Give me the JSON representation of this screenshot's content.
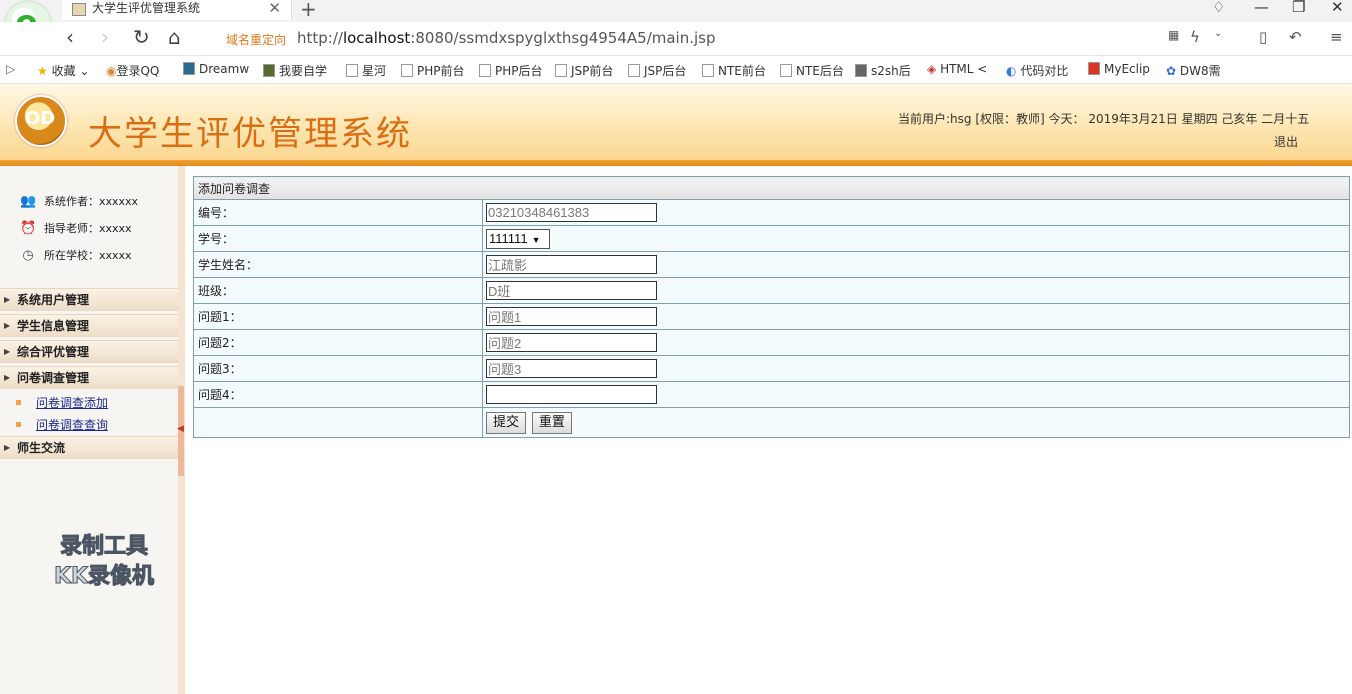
{
  "browser": {
    "tab_title": "大学生评优管理系统",
    "redirect_label": "域名重定向",
    "url_prefix": "http://",
    "url_host": "localhost",
    "url_rest": ":8080/ssmdxspyglxthsg4954A5/main.jsp",
    "bookmarks": [
      "收藏",
      "登录QQ",
      "Dreamw",
      "我要自学",
      "星河",
      "PHP前台",
      "PHP后台",
      "JSP前台",
      "JSP后台",
      "NTE前台",
      "NTE后台",
      "s2sh后",
      "HTML <",
      "代码对比",
      "MyEclip",
      "DW8需"
    ]
  },
  "header": {
    "title": "大学生评优管理系统",
    "user_info": "当前用户:hsg [权限：教师] 今天： 2019年3月21日 星期四 己亥年 二月十五",
    "logout": "退出"
  },
  "sidebar": {
    "info": [
      {
        "label": "系统作者：xxxxxx",
        "icon": "users-icon"
      },
      {
        "label": "指导老师：xxxxx",
        "icon": "alarm-icon"
      },
      {
        "label": "所在学校：xxxxx",
        "icon": "clock-icon"
      }
    ],
    "menus": [
      "系统用户管理",
      "学生信息管理",
      "综合评优管理",
      "问卷调查管理",
      "师生交流"
    ],
    "sub_items": [
      "问卷调查添加",
      "问卷调查查询"
    ],
    "watermark": [
      "录制工具",
      "KK录像机"
    ]
  },
  "form": {
    "header": "添加问卷调查",
    "fields": [
      {
        "label": "编号：",
        "value": "03210348461383"
      },
      {
        "label": "学号：",
        "value": "111111"
      },
      {
        "label": "学生姓名：",
        "value": "江疏影"
      },
      {
        "label": "班级：",
        "value": "D班"
      },
      {
        "label": "问题1：",
        "value": "问题1"
      },
      {
        "label": "问题2：",
        "value": "问题2"
      },
      {
        "label": "问题3：",
        "value": "问题3"
      },
      {
        "label": "问题4：",
        "value": ""
      }
    ],
    "submit": "提交",
    "reset": "重置"
  }
}
